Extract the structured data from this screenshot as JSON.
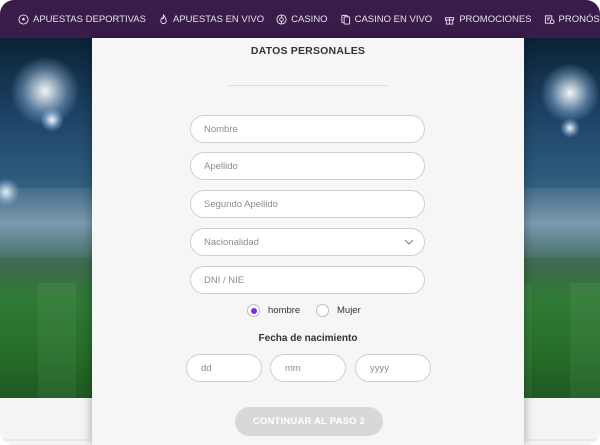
{
  "nav": {
    "items": [
      {
        "label": "APUESTAS DEPORTIVAS",
        "icon": "soccer-ball-icon"
      },
      {
        "label": "APUESTAS EN VIVO",
        "icon": "flame-icon"
      },
      {
        "label": "CASINO",
        "icon": "roulette-icon"
      },
      {
        "label": "CASINO EN VIVO",
        "icon": "cards-icon"
      },
      {
        "label": "PROMOCIONES",
        "icon": "gift-icon"
      },
      {
        "label": "PRONÓSTICOS",
        "icon": "forecast-icon"
      }
    ]
  },
  "form": {
    "title": "DATOS PERSONALES",
    "fields": {
      "nombre": "Nombre",
      "apellido": "Apellido",
      "segundo_apellido": "Segundo Apellido",
      "nacionalidad": "Nacionalidad",
      "dni": "DNI / NIE"
    },
    "gender": {
      "option_male": "hombre",
      "option_female": "Mujer",
      "selected": "hombre"
    },
    "dob": {
      "title": "Fecha de nacimiento",
      "day": "dd",
      "month": "mm",
      "year": "yyyy"
    },
    "continue_label": "CONTINUAR AL PASO 2"
  },
  "colors": {
    "nav_bg": "#3a1c4a",
    "accent_purple": "#7a2ee0",
    "button_disabled": "#d8d8d8"
  }
}
